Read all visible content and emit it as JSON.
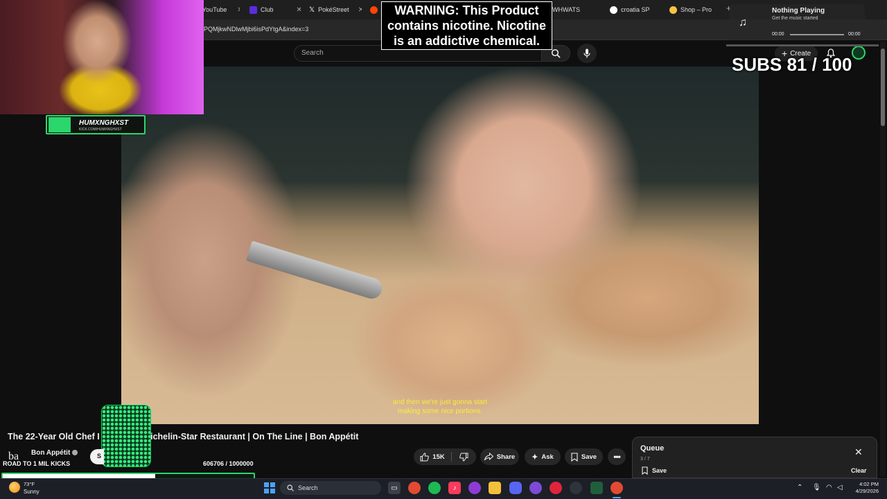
{
  "browser": {
    "tabs": [
      {
        "label": "YouTube",
        "color": "#ff0000"
      },
      {
        "label": "Club",
        "color": "#5b2be0"
      },
      {
        "label": "PokéStreet",
        "color": "#ffffff"
      },
      {
        "label": "WHWATS",
        "color": "#8a8a8a"
      },
      {
        "label": "croatia SP",
        "color": "#ffffff"
      },
      {
        "label": "Shop – Pro",
        "color": "#f5c542"
      }
    ],
    "url": "PQMjkwNDlwMjbi6isPdYtgA&index=3"
  },
  "youtube_header": {
    "search_placeholder": "Search",
    "create_label": "Create"
  },
  "overlay": {
    "warning": "WARNING: This Product contains nicotine. Nicotine is an addictive chemical.",
    "subs_text": "SUBS 81 / 100",
    "streamer_name": "HUMXNGHXST",
    "streamer_url": "KICK.COM/HUMXNGHXST",
    "music": {
      "title": "Nothing Playing",
      "subtitle": "Get the music started",
      "time_start": "00:00",
      "time_end": "00:00"
    },
    "road_label": "ROAD TO 1 MIL KICKS",
    "road_count": "606706 / 1000000",
    "road_progress": 0.606706
  },
  "video": {
    "caption_line1": "and then we're just gonna start",
    "caption_line2": "making some nice portions.",
    "title": "The 22-Year Old Chef I",
    "title_tail": "Michelin-Star Restaurant | On The Line | Bon Appétit"
  },
  "channel": {
    "logo": "ba",
    "name": "Bon Appétit",
    "subs": "",
    "subscribe_stub": "S"
  },
  "actions": {
    "likes": "15K",
    "share": "Share",
    "ask": "Ask",
    "save": "Save"
  },
  "queue": {
    "title": "Queue",
    "count": "3 / 7",
    "save": "Save",
    "clear": "Clear"
  },
  "taskbar": {
    "temp": "73°F",
    "condition": "Sunny",
    "search": "Search",
    "time": "4:02 PM",
    "date": "4/29/2026"
  }
}
